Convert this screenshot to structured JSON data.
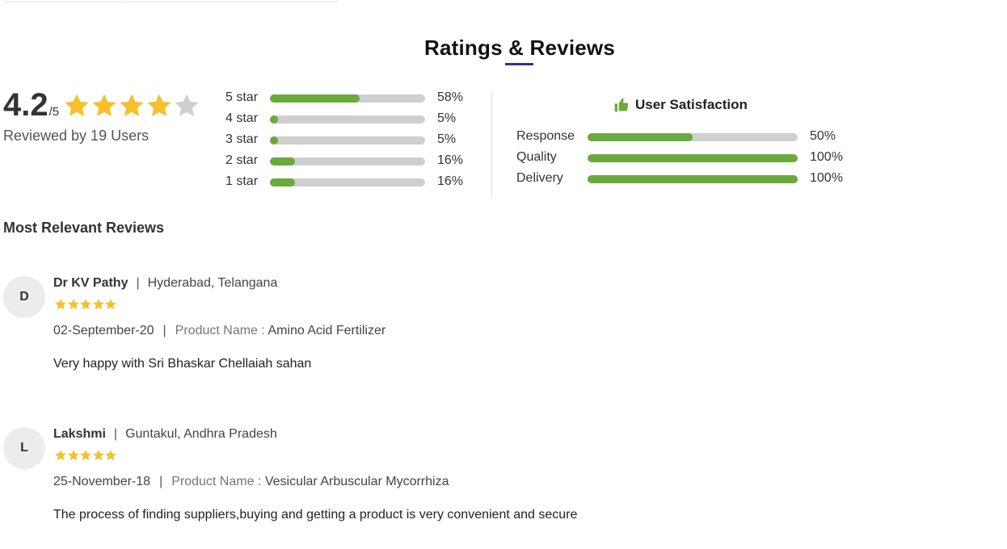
{
  "section_title": "Ratings & Reviews",
  "overall": {
    "score": "4.2",
    "out_of": "/5",
    "stars": 4.2,
    "reviewed_text": "Reviewed by 19 Users"
  },
  "distribution": [
    {
      "label": "5 star",
      "percent": 58,
      "percent_text": "58%"
    },
    {
      "label": "4 star",
      "percent": 5,
      "percent_text": "5%"
    },
    {
      "label": "3 star",
      "percent": 5,
      "percent_text": "5%"
    },
    {
      "label": "2 star",
      "percent": 16,
      "percent_text": "16%"
    },
    {
      "label": "1 star",
      "percent": 16,
      "percent_text": "16%"
    }
  ],
  "satisfaction": {
    "title": "User Satisfaction",
    "icon": "thumbs-up-icon",
    "rows": [
      {
        "label": "Response",
        "percent": 50,
        "percent_text": "50%"
      },
      {
        "label": "Quality",
        "percent": 100,
        "percent_text": "100%"
      },
      {
        "label": "Delivery",
        "percent": 100,
        "percent_text": "100%"
      }
    ]
  },
  "reviews_heading": "Most Relevant Reviews",
  "reviews": [
    {
      "initial": "D",
      "name": "Dr KV Pathy",
      "location": "Hyderabad, Telangana",
      "stars": 5,
      "date": "02-September-20",
      "product_label": "Product Name :",
      "product_name": "Amino Acid Fertilizer",
      "text": "Very happy with Sri Bhaskar Chellaiah sahan"
    },
    {
      "initial": "L",
      "name": "Lakshmi",
      "location": "Guntakul, Andhra Pradesh",
      "stars": 5,
      "date": "25-November-18",
      "product_label": "Product Name :",
      "product_name": "Vesicular Arbuscular Mycorrhiza",
      "text": "The process of finding suppliers,buying and getting a product is very convenient and secure"
    }
  ],
  "colors": {
    "star": "#f5c02c",
    "star_empty": "#cfcfcf",
    "bar_fill": "#6aaa3c",
    "bar_track": "#cfcfcf",
    "title_underline": "#2e3192"
  }
}
